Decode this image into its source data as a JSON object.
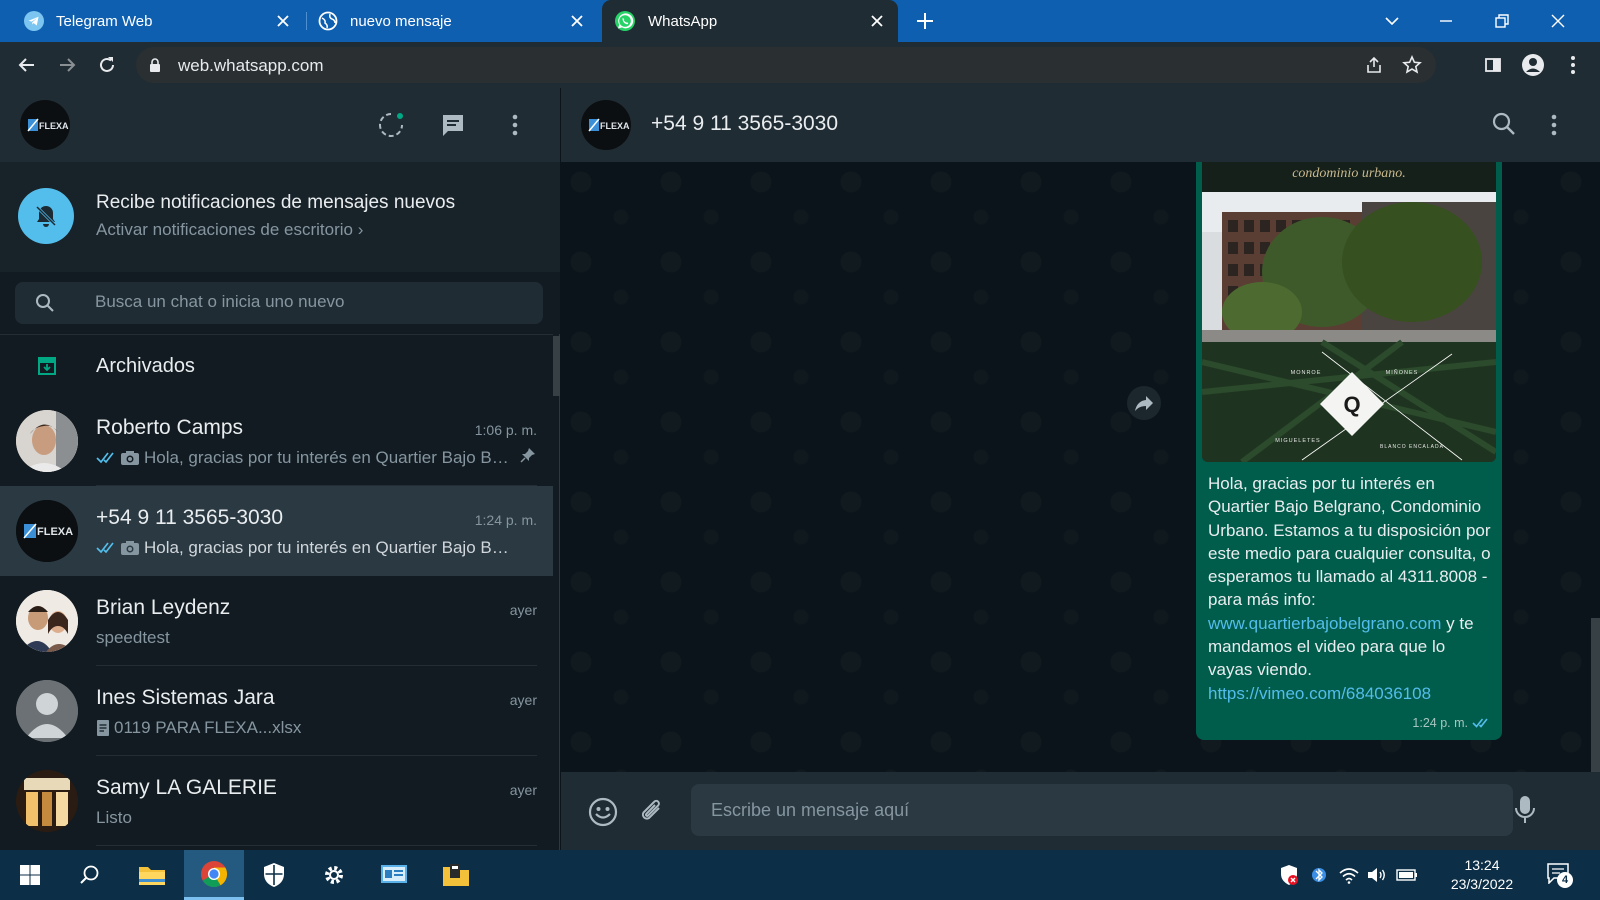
{
  "browser": {
    "tabs": [
      {
        "title": "Telegram Web",
        "icon": "telegram-icon",
        "active": false
      },
      {
        "title": "nuevo mensaje",
        "icon": "globe-icon",
        "active": false
      },
      {
        "title": "WhatsApp",
        "icon": "whatsapp-icon",
        "active": true
      }
    ],
    "url": "web.whatsapp.com",
    "colors": {
      "tabbar": "#0f5fb0",
      "toolbar": "#1f2c33"
    }
  },
  "left": {
    "notification": {
      "title": "Recibe notificaciones de mensajes nuevos",
      "subtitle": "Activar notificaciones de escritorio ›"
    },
    "search": {
      "placeholder": "Busca un chat o inicia uno nuevo"
    },
    "archived_label": "Archivados",
    "chats": [
      {
        "name": "Roberto Camps",
        "time": "1:06 p. m.",
        "preview": "Hola, gracias por tu interés en Quartier Bajo Belgrano, Condominio",
        "read": true,
        "photo": true,
        "pinned": true
      },
      {
        "name": "+54 9 11 3565-3030",
        "time": "1:24 p. m.",
        "preview": "Hola, gracias por tu interés en Quartier Bajo Belgrano, Condominio",
        "read": true,
        "photo": true,
        "selected": true
      },
      {
        "name": "Brian Leydenz",
        "time": "ayer",
        "preview": "speedtest"
      },
      {
        "name": "Ines Sistemas Jara",
        "time": "ayer",
        "preview": "0119 PARA FLEXA...xlsx",
        "doc": true
      },
      {
        "name": "Samy LA GALERIE",
        "time": "ayer",
        "preview": "Listo"
      }
    ]
  },
  "right": {
    "contact_name": "+54 9 11 3565-3030",
    "message": {
      "image_caption": "condominio urbano.",
      "image_labels": {
        "nw": "MONROE",
        "ne": "MIÑONES",
        "sw": "MIGUELETES",
        "se": "BLANCO ENCALADA",
        "center": "Q"
      },
      "text": "Hola, gracias por tu interés en Quartier Bajo Belgrano, Condominio Urbano. Estamos a tu disposición por este medio para cualquier consulta, o esperamos tu llamado al 4311.8008  - para más info:",
      "link1": "www.quartierbajobelgrano.com",
      "text2": " y te mandamos el video para que lo vayas viendo.",
      "link2": "https://vimeo.com/684036108",
      "time": "1:24 p. m."
    },
    "composer": {
      "placeholder": "Escribe un mensaje aquí"
    },
    "colors": {
      "bubble": "#005c4b",
      "link": "#53bdeb",
      "accent": "#00a884"
    }
  },
  "logo_text": "FLEXA",
  "taskbar": {
    "apps": [
      "windows-start-icon",
      "search-icon",
      "file-explorer-icon",
      "chrome-icon",
      "security-icon",
      "settings-icon",
      "control-panel-icon",
      "folder-app-icon"
    ],
    "time": "13:24",
    "date": "23/3/2022",
    "notification_count": "4"
  }
}
